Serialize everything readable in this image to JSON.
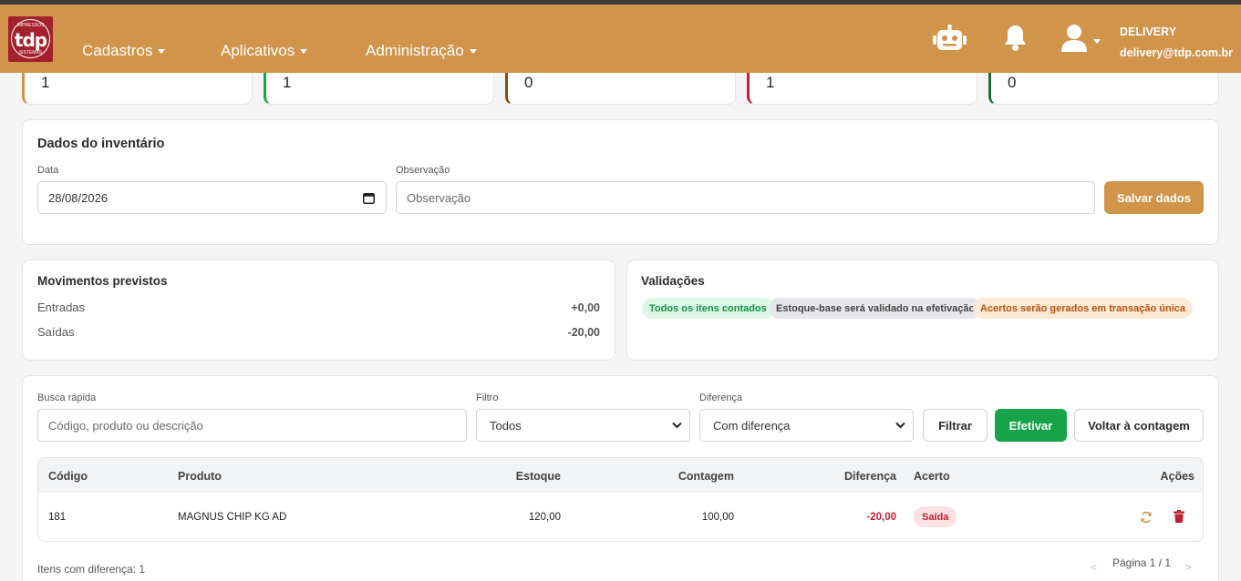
{
  "header": {
    "logo_text": "tdp",
    "logo_sub_top": "IMPRESSOS",
    "logo_sub_bottom": "SISTEMAS",
    "menu": [
      {
        "label": "Cadastros"
      },
      {
        "label": "Aplicativos"
      },
      {
        "label": "Administração"
      }
    ],
    "icons": [
      "robot-icon",
      "bell-icon",
      "user-icon"
    ],
    "user": {
      "name": "DELIVERY",
      "email": "delivery@tdp.com.br"
    },
    "colors": {
      "navbar": "#d0944a",
      "top_strip": "#3b3b3b"
    }
  },
  "stats": [
    {
      "value": "1",
      "accent": "#d0944a"
    },
    {
      "value": "1",
      "accent": "#17a34a"
    },
    {
      "value": "0",
      "accent": "#8a4a12"
    },
    {
      "value": "1",
      "accent": "#c0202f"
    },
    {
      "value": "0",
      "accent": "#1f6b32"
    }
  ],
  "inventory": {
    "title": "Dados do inventário",
    "date_label": "Data",
    "date_value": "28/08/2026",
    "obs_label": "Observação",
    "obs_placeholder": "Observação",
    "save_label": "Salvar dados"
  },
  "movements": {
    "title": "Movimentos previstos",
    "rows": [
      {
        "label": "Entradas",
        "value": "+0,00"
      },
      {
        "label": "Saídas",
        "value": "-20,00"
      }
    ]
  },
  "validations": {
    "title": "Validações",
    "pills": [
      {
        "text": "Todos os itens contados",
        "bg": "#dcf7e6",
        "fg": "#17914a"
      },
      {
        "text": "Estoque-base será validado na efetivação",
        "bg": "#e6e7ea",
        "fg": "#444444"
      },
      {
        "text": "Acertos serão gerados em transação única",
        "bg": "#fde9d4",
        "fg": "#b5520f"
      }
    ]
  },
  "filters": {
    "search_label": "Busca rápida",
    "search_placeholder": "Código, produto ou descrição",
    "filter_label": "Filtro",
    "filter_value": "Todos",
    "diff_label": "Diferença",
    "diff_value": "Com diferença",
    "filter_button": "Filtrar",
    "apply_button": "Efetivar",
    "back_button": "Voltar à contagem"
  },
  "table": {
    "headers": [
      "Código",
      "Produto",
      "Estoque",
      "Contagem",
      "Diferença",
      "Acerto",
      "Ações"
    ],
    "rows": [
      {
        "codigo": "181",
        "produto": "MAGNUS CHIP KG AD",
        "estoque": "120,00",
        "contagem": "100,00",
        "diferenca": "-20,00",
        "acerto": "Saída"
      }
    ]
  },
  "footer": {
    "items_diff": "Itens com diferença: 1",
    "page": "Página 1 / 1",
    "prev": "<",
    "next": ">"
  }
}
